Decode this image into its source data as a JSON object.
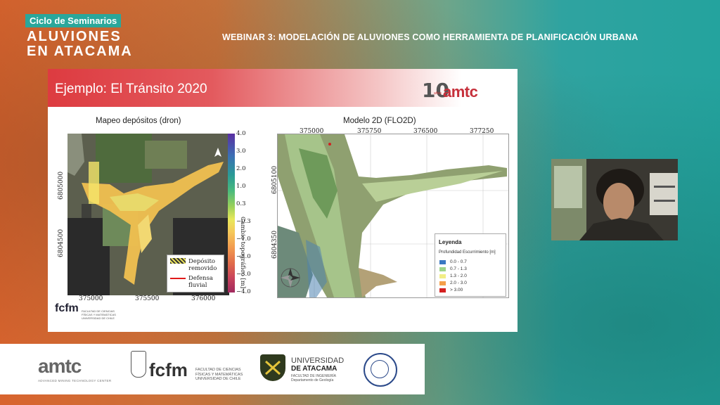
{
  "overlay": {
    "series_badge": "Ciclo de Seminarios",
    "series_title_line1": "ALUVIONES",
    "series_title_line2": "EN ATACAMA",
    "webinar_title": "WEBINAR 3: MODELACIÓN DE ALUVIONES COMO HERRAMIENTA DE PLANIFICACIÓN URBANA"
  },
  "slide": {
    "title": "Ejemplo: El Tránsito 2020",
    "header_logo": {
      "ten": "10",
      "anos": "años",
      "word": "amtc"
    },
    "left_panel": {
      "title": "Mapeo depósitos (dron)",
      "x_ticks": [
        "375000",
        "375500",
        "376000"
      ],
      "y_ticks": [
        "6805000",
        "6804500"
      ],
      "colorbar_ticks": [
        "4.0",
        "3.0",
        "2.0",
        "1.0",
        "0.3",
        "−0.3",
        "−1.0",
        "−2.0",
        "−3.0",
        "−4.0"
      ],
      "colorbar_label": "Cambio topográfico [m]",
      "legend": {
        "deposit_line1": "Depósito",
        "deposit_line2": "removido",
        "defense_line1": "Defensa",
        "defense_line2": "fluvial"
      }
    },
    "right_panel": {
      "title": "Modelo 2D (FLO2D)",
      "x_ticks": [
        "375000",
        "375750",
        "376500",
        "377250"
      ],
      "y_ticks": [
        "6805100",
        "6804350"
      ],
      "legend": {
        "title": "Leyenda",
        "subtitle": "Profundidad Escurrimiento [m]",
        "items": [
          {
            "label": "0.0 - 0.7",
            "color": "#3a78c2"
          },
          {
            "label": "0.7 - 1.3",
            "color": "#9ed48a"
          },
          {
            "label": "1.3 - 2.0",
            "color": "#f2ee86"
          },
          {
            "label": "2.0 - 3.0",
            "color": "#f5a04a"
          },
          {
            "label": "> 3.00",
            "color": "#d42020"
          }
        ]
      }
    },
    "footer_logo": "fcfm",
    "footer_logo_sub": "FACULTAD DE CIENCIAS FÍSICAS Y MATEMÁTICAS UNIVERSIDAD DE CHILE"
  },
  "bottom_bar": {
    "amtc": "amtc",
    "amtc_sub": "ADVANCED MINING TECHNOLOGY CENTER",
    "fcfm": "fcfm",
    "fcfm_sub": "FACULTAD DE CIENCIAS FÍSICAS Y MATEMÁTICAS UNIVERSIDAD DE CHILE",
    "ua_line1": "UNIVERSIDAD",
    "ua_line2": "DE ATACAMA",
    "ua_line3": "FACULTAD DE INGENIERÍA",
    "ua_line4": "Departamento de Geología"
  }
}
